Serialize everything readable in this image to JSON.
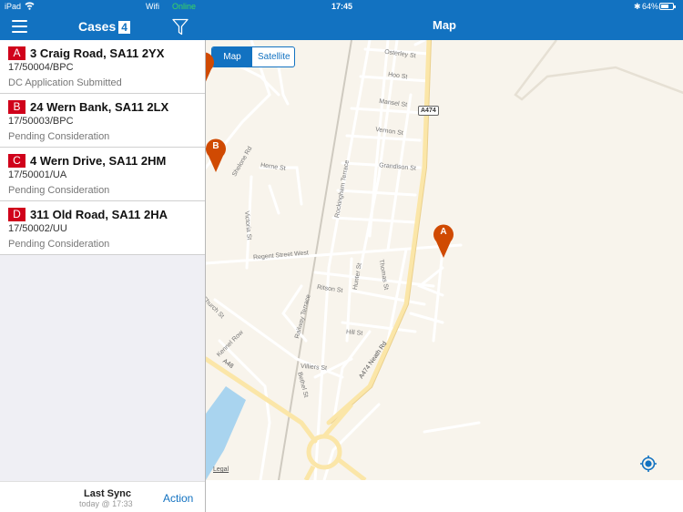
{
  "status_bar": {
    "device": "iPad",
    "network_label": "Wifi",
    "connection_status": "Online",
    "time": "17:45",
    "bluetooth": "✱",
    "battery_percent": "64%",
    "battery_level": 0.64
  },
  "left_panel": {
    "title": "Cases",
    "count": "4",
    "cases": [
      {
        "letter": "A",
        "address": "3 Craig Road, SA11 2YX",
        "reference": "17/50004/BPC",
        "status": "DC Application Submitted"
      },
      {
        "letter": "B",
        "address": "24 Wern Bank, SA11 2LX",
        "reference": "17/50003/BPC",
        "status": "Pending Consideration"
      },
      {
        "letter": "C",
        "address": "4 Wern Drive, SA11 2HM",
        "reference": "17/50001/UA",
        "status": "Pending Consideration"
      },
      {
        "letter": "D",
        "address": "311 Old Road, SA11 2HA",
        "reference": "17/50002/UU",
        "status": "Pending Consideration"
      }
    ],
    "footer": {
      "sync_title": "Last Sync",
      "sync_time": "today @ 17:33",
      "action_label": "Action"
    }
  },
  "right_panel": {
    "title": "Map",
    "map_type_options": [
      "Map",
      "Satellite"
    ],
    "selected_map_type": "Map",
    "pins": [
      {
        "label": "A"
      },
      {
        "label": "B"
      }
    ],
    "road_shield": "A474",
    "road_labels": {
      "osterley": "Osterley St",
      "hoo": "Hoo St",
      "mansel": "Mansel St",
      "vernon": "Vernon St",
      "grandison": "Grandison St",
      "herne": "Herne St",
      "shelone": "Shelone Rd",
      "rockingham": "Rockingham Terrace",
      "victoria": "Victoria St",
      "regent": "Regent Street West",
      "hunter": "Hunter St",
      "thomas": "Thomas St",
      "ritson": "Ritson St",
      "railway": "Railway Terrace",
      "church": "Church St",
      "kennel": "Kennel Row",
      "hill": "Hill St",
      "villiers": "Villiers St",
      "bethel": "Bethel St",
      "neath": "A474  Neath Rd",
      "a48": "A48"
    },
    "legal_label": "Legal",
    "colors": {
      "brand": "#1272c1",
      "case_badge": "#d0021b",
      "pin": "#d04a02",
      "map_bg": "#f8f4ec",
      "water": "#a9d4ef",
      "major_road": "#fbe6a8"
    }
  }
}
